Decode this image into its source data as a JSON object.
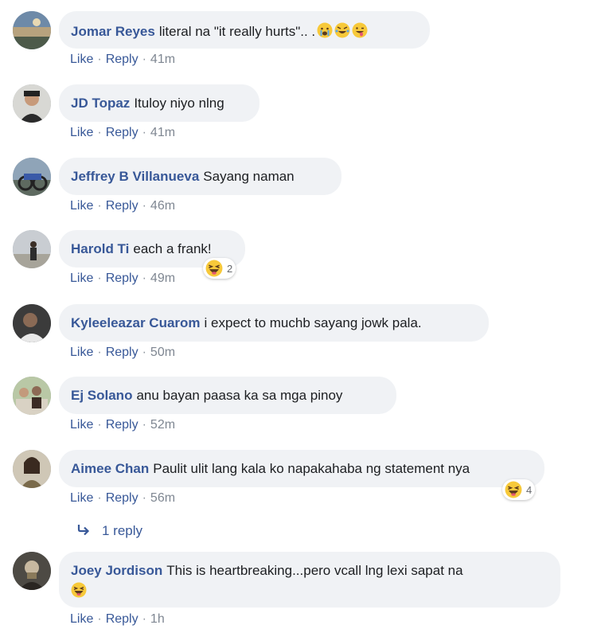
{
  "actions": {
    "like": "Like",
    "reply": "Reply",
    "sep": "·"
  },
  "comments": [
    {
      "author": "Jomar Reyes",
      "text": "literal na \"it really hurts\".. .",
      "emojis": [
        "crying-face",
        "rofl-face",
        "zany-face"
      ],
      "time": "41m"
    },
    {
      "author": "JD Topaz",
      "text": "Ituloy niyo nlng",
      "time": "41m"
    },
    {
      "author": "Jeffrey B Villanueva",
      "text": "Sayang naman",
      "time": "46m"
    },
    {
      "author": "Harold Ti",
      "text": "each a frank!",
      "time": "49m",
      "reaction": {
        "icon": "haha-reaction-icon",
        "count": "2"
      }
    },
    {
      "author": "Kyleeleazar Cuarom",
      "text": "i expect to muchb sayang jowk pala.",
      "time": "50m"
    },
    {
      "author": "Ej Solano",
      "text": "anu bayan paasa ka sa mga pinoy",
      "time": "52m"
    },
    {
      "author": "Aimee Chan",
      "text": "Paulit ulit lang kala ko napakahaba ng statement nya",
      "time": "56m",
      "reaction": {
        "icon": "haha-reaction-icon",
        "count": "4"
      },
      "replies": "1 reply"
    },
    {
      "author": "Joey Jordison",
      "text": "This is heartbreaking...pero vcall lng lexi sapat na",
      "emojis": [
        "laughing-face"
      ],
      "time": "1h"
    }
  ]
}
